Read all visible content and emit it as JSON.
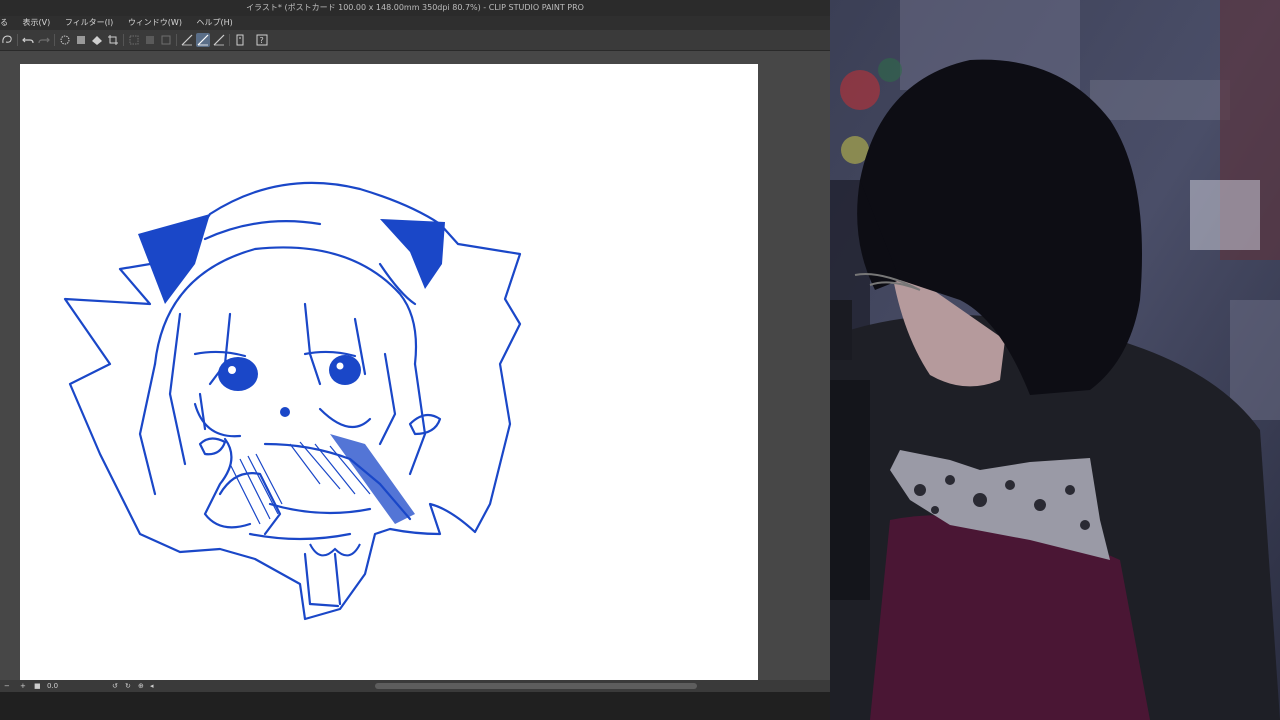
{
  "window": {
    "title": "イラスト* (ポストカード 100.00 x 148.00mm 350dpi 80.7%) - CLIP STUDIO PAINT PRO"
  },
  "menu": {
    "items": [
      "る",
      "表示(V)",
      "フィルター(I)",
      "ウィンドウ(W)",
      "ヘルプ(H)"
    ]
  },
  "status": {
    "zoom_readout": "0.0"
  },
  "colors": {
    "ink_blue": "#1a47c8",
    "app_dark": "#2f2f2f",
    "canvas_gray": "#474747",
    "paper": "#ffffff"
  },
  "icons": {
    "toolbar": [
      "lasso-icon",
      "undo-icon",
      "redo-icon",
      "clear-icon",
      "fill-icon",
      "transform-icon",
      "select-none-icon",
      "invert-selection-icon",
      "crop-icon",
      "pen-icon",
      "pen-pressure-icon",
      "ruler-icon",
      "layer-icon",
      "help-icon"
    ]
  }
}
